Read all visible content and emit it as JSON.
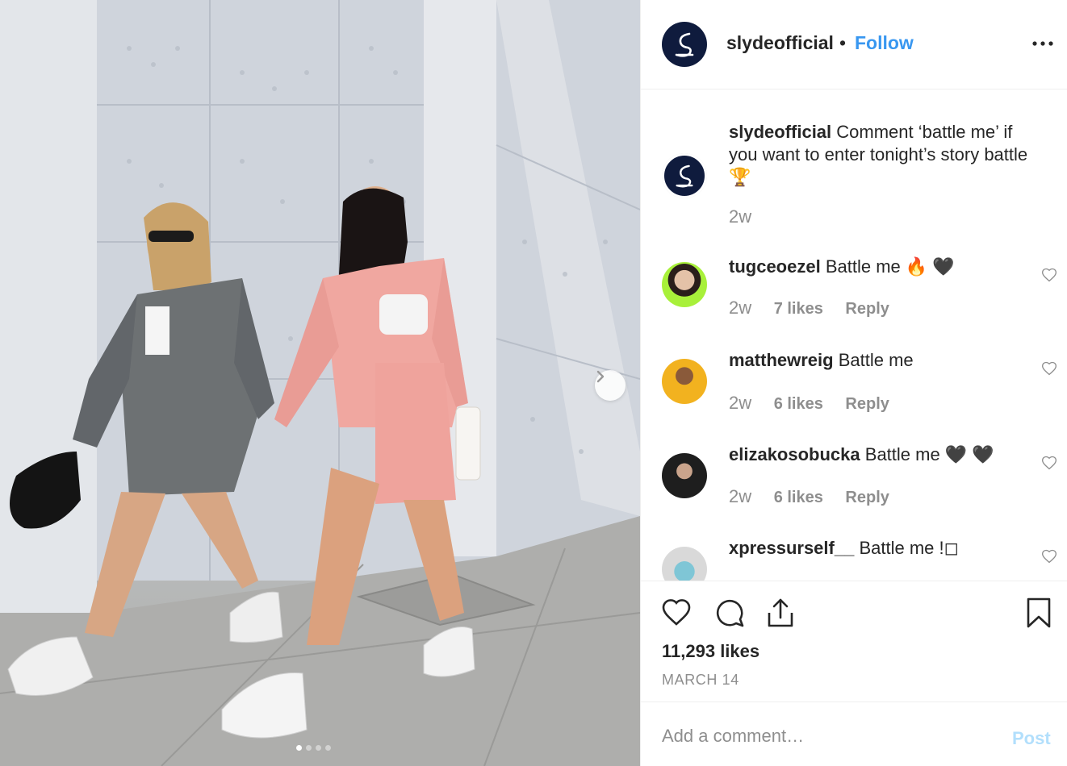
{
  "photo": {
    "carousel_total": 4,
    "carousel_active": 1,
    "next_icon": "chevron-right-icon"
  },
  "header": {
    "username": "slydeofficial",
    "separator": "•",
    "follow_label": "Follow",
    "more_icon": "more-horizontal-icon"
  },
  "caption": {
    "username": "slydeofficial",
    "text": "Comment ‘battle me’ if you want to enter tonight’s story battle 🏆",
    "time": "2w"
  },
  "comments": [
    {
      "username": "tugceoezel",
      "text": "Battle me 🔥 🖤",
      "time": "2w",
      "likes": "7 likes",
      "reply": "Reply"
    },
    {
      "username": "matthewreig",
      "text": "Battle me",
      "time": "2w",
      "likes": "6 likes",
      "reply": "Reply"
    },
    {
      "username": "elizakosobucka",
      "text": "Battle me 🖤 🖤",
      "time": "2w",
      "likes": "6 likes",
      "reply": "Reply"
    },
    {
      "username": "xpressurself__",
      "text": "Battle me !◻",
      "time": "",
      "likes": "",
      "reply": ""
    }
  ],
  "actions": {
    "likes_count": "11,293 likes",
    "date": "MARCH 14",
    "icons": [
      "heart-icon",
      "comment-icon",
      "share-icon",
      "bookmark-icon"
    ]
  },
  "add_comment": {
    "placeholder": "Add a comment…",
    "post_label": "Post"
  },
  "colors": {
    "link_blue": "#3897f0",
    "post_disabled": "#b2dffc",
    "muted": "#8e8e8e",
    "text": "#262626",
    "brand_avatar": "#0f1b3d"
  }
}
